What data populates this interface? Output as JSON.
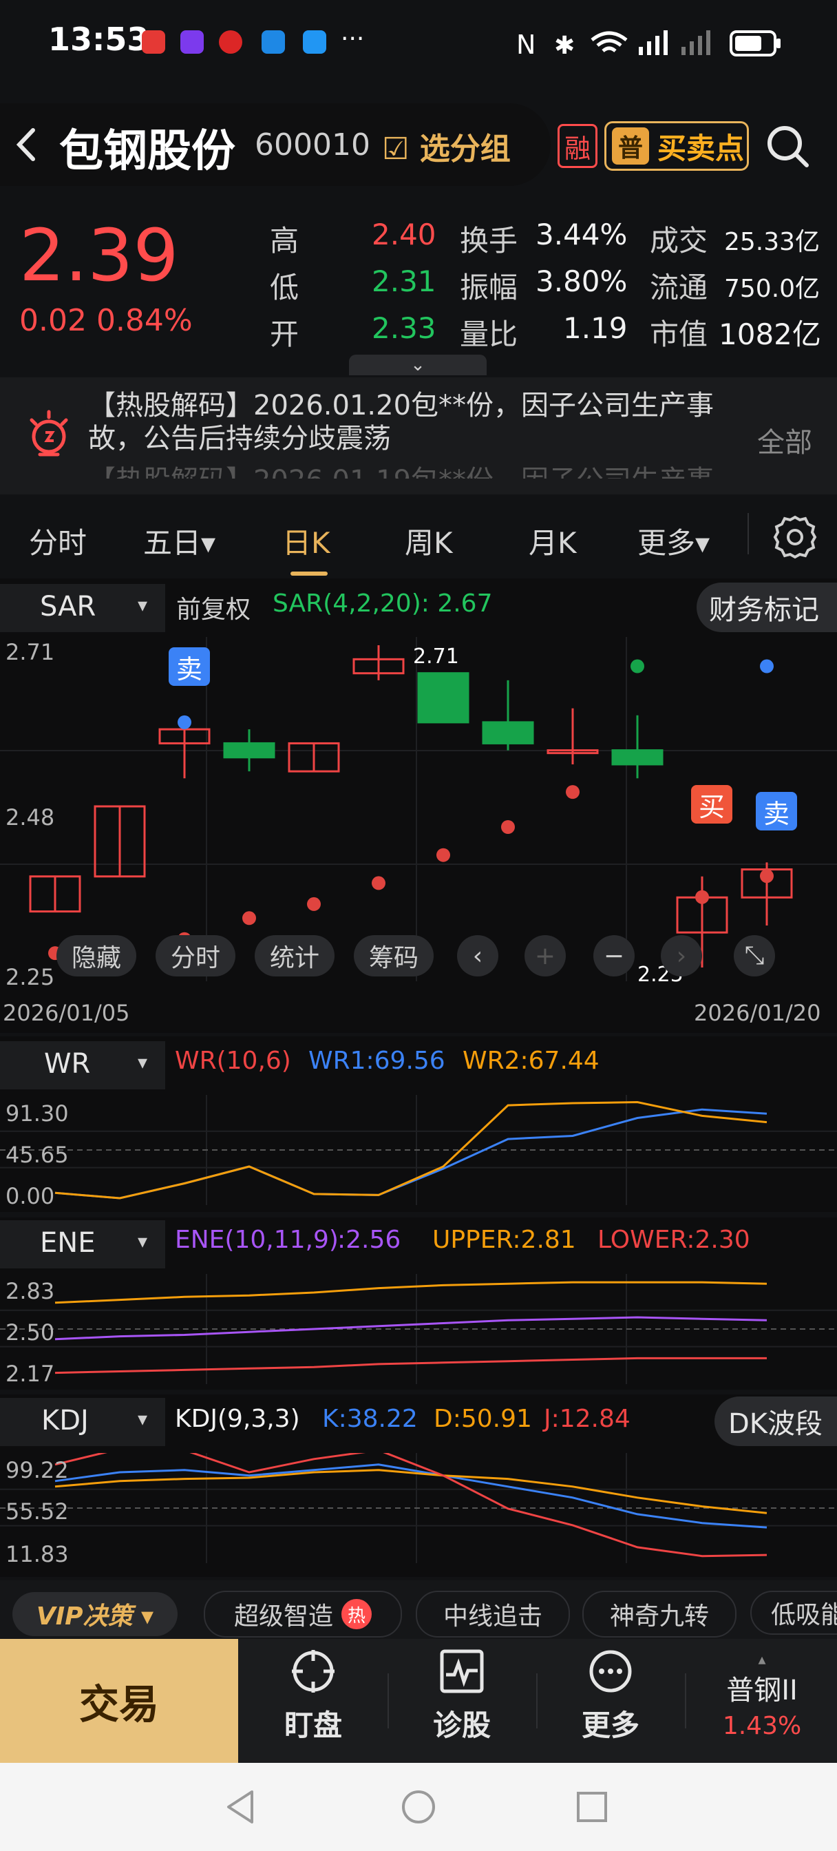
{
  "status": {
    "time": "13:53",
    "indicators": [
      "nfc-icon",
      "bluetooth-icon",
      "wifi-icon",
      "signal-icon",
      "battery-icon"
    ],
    "more": "···"
  },
  "header": {
    "back_icon": "chevron-left-icon",
    "stock_name": "包钢股份",
    "stock_code": "600010",
    "group_label": "选分组",
    "rong": "融",
    "buy_sell_icon": "普",
    "buy_sell_label": "买卖点"
  },
  "quote": {
    "price": "2.39",
    "change": "0.02 0.84%",
    "high_label": "高",
    "high": "2.40",
    "low_label": "低",
    "low": "2.31",
    "open_label": "开",
    "open": "2.33",
    "turnover_label": "换手",
    "turnover": "3.44%",
    "amplitude_label": "振幅",
    "amplitude": "3.80%",
    "volume_ratio_label": "量比",
    "volume_ratio": "1.19",
    "deal_label": "成交",
    "deal": "25.33亿",
    "float_label": "流通",
    "float": "750.0亿",
    "mktcap_label": "市值",
    "mktcap": "1082亿"
  },
  "news": {
    "text": "【热股解码】2026.01.20包**份，因子公司生产事故，公告后持续分歧震荡",
    "next": "【热股解码】2026.01.19包**份，因子公司生产事",
    "all": "全部"
  },
  "tabs": {
    "items": [
      "分时",
      "五日▾",
      "日K",
      "周K",
      "月K",
      "更多▾"
    ],
    "active": "日K"
  },
  "main_chart": {
    "indicator": "SAR",
    "adjust": "前复权",
    "legend": "SAR(4,2,20):  2.67",
    "financial": "财务标记",
    "y_top": "2.71",
    "y_mid": "2.48",
    "y_bot": "2.25",
    "hi_label": "2.71",
    "lo_label": "2.25",
    "date_start": "2026/01/05",
    "date_end": "2026/01/20",
    "sell": "卖",
    "buy": "买",
    "tools": [
      "隐藏",
      "分时",
      "统计",
      "筹码"
    ]
  },
  "wr": {
    "name": "WR",
    "params": "WR(10,6)",
    "wr1": "WR1:69.56",
    "wr2": "WR2:67.44",
    "y_top": "91.30",
    "y_mid": "45.65",
    "y_bot": "0.00"
  },
  "ene": {
    "name": "ENE",
    "params": "ENE(10,11,9)",
    "value": ":2.56",
    "upper": "UPPER:2.81",
    "lower": "LOWER:2.30",
    "y_top": "2.83",
    "y_mid": "2.50",
    "y_bot": "2.17"
  },
  "kdj": {
    "name": "KDJ",
    "params": "KDJ(9,3,3)",
    "k": "K:38.22",
    "d": "D:50.91",
    "j": "J:12.84",
    "y_top": "99.22",
    "y_mid": "55.52",
    "y_bot": "11.83",
    "dk_button": "DK波段"
  },
  "features": {
    "vip": "VIP决策 ▾",
    "items": [
      "超级智造",
      "中线追击",
      "神奇九转",
      "低吸能"
    ],
    "hot": "热"
  },
  "bottom_bar": {
    "trade": "交易",
    "watch": "盯盘",
    "diagnose": "诊股",
    "more": "更多",
    "related_name": "普钢II",
    "related_change": "1.43%"
  },
  "chart_data": [
    {
      "type": "candlestick",
      "indicator": "SAR(4,2,20)",
      "x_start": "2026/01/05",
      "x_end": "2026/01/20",
      "ylim": [
        2.25,
        2.71
      ],
      "candles": [
        {
          "o": 2.33,
          "h": 2.38,
          "l": 2.33,
          "c": 2.38
        },
        {
          "o": 2.38,
          "h": 2.48,
          "l": 2.38,
          "c": 2.48
        },
        {
          "o": 2.57,
          "h": 2.6,
          "l": 2.52,
          "c": 2.59
        },
        {
          "o": 2.57,
          "h": 2.59,
          "l": 2.53,
          "c": 2.55
        },
        {
          "o": 2.53,
          "h": 2.57,
          "l": 2.53,
          "c": 2.57
        },
        {
          "o": 2.67,
          "h": 2.71,
          "l": 2.66,
          "c": 2.69
        },
        {
          "o": 2.67,
          "h": 2.67,
          "l": 2.6,
          "c": 2.6
        },
        {
          "o": 2.6,
          "h": 2.66,
          "l": 2.56,
          "c": 2.57
        },
        {
          "o": 2.56,
          "h": 2.62,
          "l": 2.54,
          "c": 2.56
        },
        {
          "o": 2.56,
          "h": 2.61,
          "l": 2.52,
          "c": 2.54
        },
        {
          "o": 2.3,
          "h": 2.38,
          "l": 2.25,
          "c": 2.35
        },
        {
          "o": 2.35,
          "h": 2.4,
          "l": 2.31,
          "c": 2.39
        }
      ],
      "sar": [
        2.3,
        2.31,
        2.32,
        2.35,
        2.37,
        2.4,
        2.44,
        2.48,
        2.53,
        null,
        2.38,
        2.41
      ],
      "sar_high": [
        null,
        null,
        2.6,
        null,
        null,
        null,
        null,
        null,
        null,
        2.68,
        null,
        2.68
      ]
    },
    {
      "type": "line",
      "name": "WR(10,6)",
      "ylim": [
        0,
        91.3
      ],
      "series": [
        {
          "name": "WR1",
          "color": "#3b82f6",
          "values": [
            5,
            0,
            14,
            30,
            4,
            3,
            28,
            56,
            59,
            76,
            84,
            80
          ]
        },
        {
          "name": "WR2",
          "color": "#f59e0b",
          "values": [
            5,
            0,
            14,
            30,
            4,
            3,
            30,
            88,
            90,
            91,
            78,
            72
          ]
        }
      ]
    },
    {
      "type": "line",
      "name": "ENE(10,11,9)",
      "ylim": [
        2.17,
        2.83
      ],
      "series": [
        {
          "name": "UPPER",
          "color": "#f59e0b",
          "values": [
            2.68,
            2.7,
            2.72,
            2.73,
            2.75,
            2.78,
            2.8,
            2.81,
            2.82,
            2.82,
            2.82,
            2.81
          ]
        },
        {
          "name": "ENE",
          "color": "#a855f7",
          "values": [
            2.43,
            2.45,
            2.46,
            2.48,
            2.5,
            2.52,
            2.54,
            2.56,
            2.57,
            2.58,
            2.57,
            2.56
          ]
        },
        {
          "name": "LOWER",
          "color": "#ef4444",
          "values": [
            2.2,
            2.21,
            2.22,
            2.23,
            2.24,
            2.26,
            2.27,
            2.28,
            2.29,
            2.3,
            2.3,
            2.3
          ]
        }
      ]
    },
    {
      "type": "line",
      "name": "KDJ(9,3,3)",
      "ylim": [
        11.83,
        99.22
      ],
      "series": [
        {
          "name": "K",
          "color": "#3b82f6",
          "values": [
            80,
            88,
            90,
            85,
            90,
            95,
            85,
            75,
            65,
            50,
            42,
            38
          ]
        },
        {
          "name": "D",
          "color": "#f59e0b",
          "values": [
            75,
            80,
            82,
            83,
            88,
            90,
            85,
            82,
            75,
            65,
            57,
            51
          ]
        },
        {
          "name": "J",
          "color": "#ef4444",
          "values": [
            95,
            112,
            108,
            88,
            100,
            108,
            85,
            55,
            40,
            20,
            12,
            13
          ]
        }
      ]
    }
  ]
}
